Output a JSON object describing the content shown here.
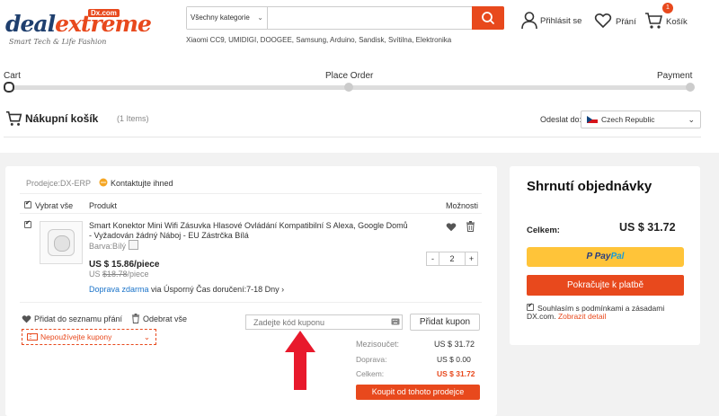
{
  "logo": {
    "deal": "deal",
    "extreme": "extreme",
    "dx": "Dx.com",
    "tagline": "Smart Tech & Life Fashion"
  },
  "search": {
    "category": "Všechny kategorie",
    "placeholder": "",
    "hints": "Xiaomi CC9, UMIDIGI, DOOGEE, Samsung, Arduino, Sandisk, Svítilna, Elektronika"
  },
  "header_actions": {
    "login": "Přihlásit se",
    "wishlist": "Přání",
    "cart": "Košík",
    "cart_count": "1"
  },
  "progress": {
    "steps": [
      "Cart",
      "Place Order",
      "Payment"
    ],
    "current_step": 0
  },
  "cart": {
    "title": "Nákupní košík",
    "count": "(1 Items)",
    "ship_to_label": "Odeslat do:",
    "ship_to_value": "Czech Republic"
  },
  "seller": {
    "label": "Prodejce:DX-ERP",
    "contact": "Kontaktujte ihned"
  },
  "table": {
    "select_all": "Vybrat vše",
    "product": "Produkt",
    "options": "Možnosti"
  },
  "item": {
    "title_line1": "Smart Konektor Mini Wifi Zásuvka Hlasové Ovládání Kompatibilní S Alexa, Google Domů",
    "title_line2": "- Vyžadován žádný Náboj - EU Zástrčka Bílá",
    "color_label": "Barva:Bílý",
    "price": "US $ 15.86/piece",
    "old_price_prefix": "US ",
    "old_price": "$18.78",
    "old_price_suffix": "/piece",
    "shipping_link": "Doprava zdarma",
    "shipping_text": "via Úsporný Čas doručení:7-18 Dny",
    "quantity": "2",
    "minus": "-",
    "plus": "+"
  },
  "actions": {
    "add_wishlist": "Přidat do seznamu přání",
    "remove_all": "Odebrat vše"
  },
  "coupon": {
    "placeholder": "Zadejte kód kuponu",
    "apply": "Přidat kupon",
    "no_coupon": "Nepoužívejte kupony"
  },
  "totals": {
    "subtotal_label": "Mezisoučet:",
    "subtotal": "US $ 31.72",
    "shipping_label": "Doprava:",
    "shipping": "US $ 0.00",
    "total_label": "Celkem:",
    "total": "US $ 31.72",
    "buy_button": "Koupit od tohoto prodejce"
  },
  "summary": {
    "title": "Shrnutí objednávky",
    "total_label": "Celkem:",
    "total": "US $ 31.72",
    "paypal_pay": "Pay",
    "paypal_pal": "Pal",
    "checkout": "Pokračujte k platbě",
    "agree_text1": "Souhlasím s podmínkami a zásadami",
    "agree_text2": "DX.com.",
    "agree_link": "Zobrazit detail"
  },
  "colors": {
    "accent": "#e8491d",
    "brand_blue": "#1f3f6e",
    "link": "#1a73c9",
    "paypal": "#ffc439",
    "arrow": "#e8192c"
  },
  "icons": [
    "search-icon",
    "user-icon",
    "heart-icon",
    "cart-icon",
    "chat-icon",
    "trash-icon",
    "coupon-icon",
    "chevron-down-icon",
    "flag-cz-icon"
  ]
}
